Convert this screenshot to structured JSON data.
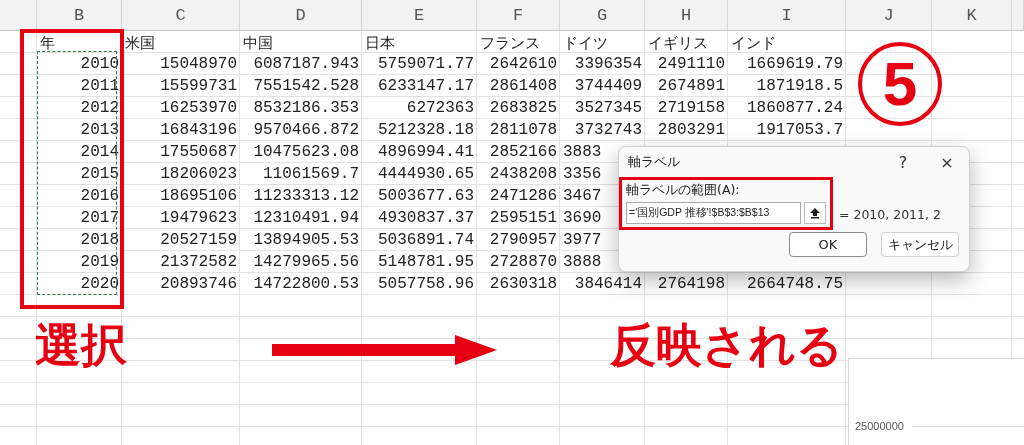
{
  "column_headers": [
    {
      "label": "B"
    },
    {
      "label": "C"
    },
    {
      "label": "D"
    },
    {
      "label": "E"
    },
    {
      "label": "F"
    },
    {
      "label": "G"
    },
    {
      "label": "H"
    },
    {
      "label": "I"
    },
    {
      "label": "J"
    },
    {
      "label": "K"
    }
  ],
  "rows": [
    {
      "kind": "header",
      "cells": [
        "年",
        "米国",
        "中国",
        "日本",
        "フランス",
        "ドイツ",
        "イギリス",
        "インド"
      ]
    },
    {
      "kind": "data",
      "cells": [
        "2010",
        "15048970",
        "6087187.943",
        "5759071.77",
        "2642610",
        "3396354",
        "2491110",
        "1669619.79"
      ]
    },
    {
      "kind": "data",
      "cells": [
        "2011",
        "15599731",
        "7551542.528",
        "6233147.17",
        "2861408",
        "3744409",
        "2674891",
        "1871918.5"
      ]
    },
    {
      "kind": "data",
      "cells": [
        "2012",
        "16253970",
        "8532186.353",
        "6272363",
        "2683825",
        "3527345",
        "2719158",
        "1860877.24"
      ]
    },
    {
      "kind": "data",
      "cells": [
        "2013",
        "16843196",
        "9570466.872",
        "5212328.18",
        "2811078",
        "3732743",
        "2803291",
        "1917053.7"
      ]
    },
    {
      "kind": "data",
      "covered": true,
      "cells": [
        "2014",
        "17550687",
        "10475623.08",
        "4896994.41",
        "2852166",
        "3883"
      ]
    },
    {
      "kind": "data",
      "covered": true,
      "cells": [
        "2015",
        "18206023",
        "11061569.7",
        "4444930.65",
        "2438208",
        "3356"
      ]
    },
    {
      "kind": "data",
      "covered": true,
      "cells": [
        "2016",
        "18695106",
        "11233313.12",
        "5003677.63",
        "2471286",
        "3467"
      ]
    },
    {
      "kind": "data",
      "covered": true,
      "cells": [
        "2017",
        "19479623",
        "12310491.94",
        "4930837.37",
        "2595151",
        "3690"
      ]
    },
    {
      "kind": "data",
      "covered": true,
      "cells": [
        "2018",
        "20527159",
        "13894905.53",
        "5036891.74",
        "2790957",
        "3977"
      ]
    },
    {
      "kind": "data",
      "covered": true,
      "cells": [
        "2019",
        "21372582",
        "14279965.56",
        "5148781.95",
        "2728870",
        "3888"
      ]
    },
    {
      "kind": "data",
      "cells": [
        "2020",
        "20893746",
        "14722800.53",
        "5057758.96",
        "2630318",
        "3846414",
        "2764198",
        "2664748.75"
      ]
    }
  ],
  "step_number": "5",
  "annotations": {
    "selection_label": "選択",
    "result_label": "反映される"
  },
  "dialog": {
    "title": "軸ラベル",
    "help": "?",
    "close": "×",
    "field_label": "軸ラベルの範囲(A):",
    "field_value": "='国別GDP 推移'!$B$3:$B$13",
    "preview": "= 2010, 2011, 2",
    "buttons": [
      {
        "label": "OK",
        "kind": "primary"
      },
      {
        "label": "キャンセル",
        "kind": "secondary"
      }
    ]
  },
  "chart_fragment": {
    "axis_label": "25000000"
  }
}
